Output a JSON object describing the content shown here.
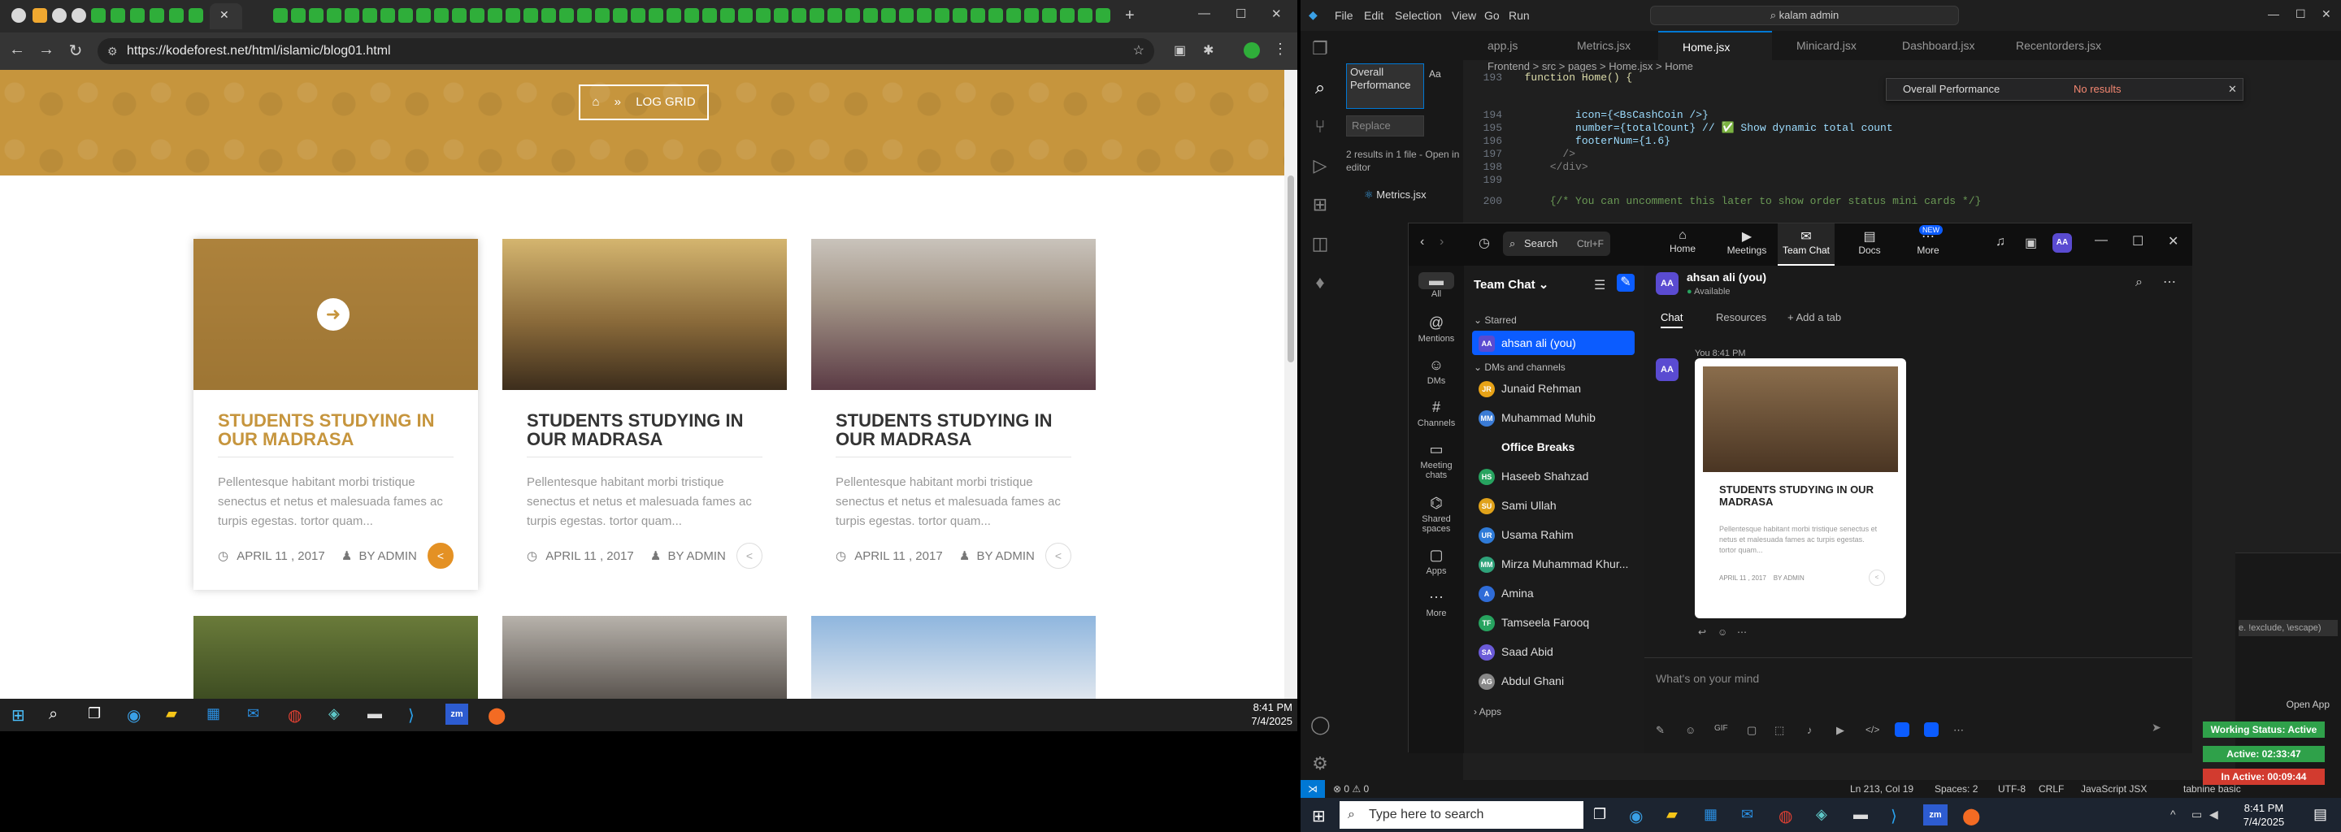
{
  "browser": {
    "url": "https://kodeforest.net/html/islamic/blog01.html",
    "close_tab_glyph": "✕",
    "new_tab_glyph": "+",
    "window_controls": [
      "—",
      "☐",
      "✕"
    ]
  },
  "hero": {
    "breadcrumb_icon": "home-icon",
    "breadcrumb_sep": "»",
    "breadcrumb_label": "LOG GRID"
  },
  "blog_cards": [
    {
      "title": "STUDENTS STUDYING IN OUR MADRASA",
      "desc": "Pellentesque habitant morbi tristique senectus et netus et malesuada fames ac turpis egestas. tortor quam...",
      "date": "APRIL 11 , 2017",
      "author": "BY ADMIN"
    },
    {
      "title": "STUDENTS STUDYING IN OUR MADRASA",
      "desc": "Pellentesque habitant morbi tristique senectus et netus et malesuada fames ac turpis egestas. tortor quam...",
      "date": "APRIL 11 , 2017",
      "author": "BY ADMIN"
    },
    {
      "title": "STUDENTS STUDYING IN OUR MADRASA",
      "desc": "Pellentesque habitant morbi tristique senectus et netus et malesuada fames ac turpis egestas. tortor quam...",
      "date": "APRIL 11 , 2017",
      "author": "BY ADMIN"
    }
  ],
  "left_taskbar": {
    "time": "8:41 PM",
    "date": "7/4/2025"
  },
  "vscode": {
    "menu": [
      "File",
      "Edit",
      "Selection",
      "View",
      "Go",
      "Run"
    ],
    "search_title": "kalam admin",
    "tabs": [
      "app.js",
      "Metrics.jsx",
      "Home.jsx",
      "Minicard.jsx",
      "Dashboard.jsx",
      "Recentorders.jsx"
    ],
    "active_tab": "Home.jsx",
    "breadcrumb": "Frontend > src > pages > Home.jsx > Home",
    "search_input": "Overall Performance",
    "replace_placeholder": "Replace",
    "results_text": "2 results in 1 file - Open in editor",
    "result_file": "Metrics.jsx",
    "find_widget_value": "Overall Performance",
    "find_widget_result": "No results",
    "code_lines": [
      {
        "n": "193",
        "t": "  function Home() {"
      },
      {
        "n": "194",
        "t": "          icon={<BsCashCoin />}"
      },
      {
        "n": "195",
        "t": "          number={totalCount} // ✅ Show dynamic total count"
      },
      {
        "n": "196",
        "t": "          footerNum={1.6}"
      },
      {
        "n": "197",
        "t": "        />"
      },
      {
        "n": "198",
        "t": "      </div>"
      },
      {
        "n": "199",
        "t": ""
      },
      {
        "n": "200",
        "t": "      {/* You can uncomment this later to show order status mini cards */}"
      }
    ],
    "status": {
      "left": "⊗ 0 ⚠ 0",
      "position": "Ln 213, Col 19",
      "spaces": "Spaces: 2",
      "encoding": "UTF-8",
      "eol": "CRLF",
      "lang": "JavaScript JSX",
      "ext": "tabnine basic"
    },
    "regex_hint": "e. !exclude, \\escape)"
  },
  "teams": {
    "search_label": "Search",
    "search_shortcut": "Ctrl+F",
    "nav": [
      "Home",
      "Meetings",
      "Team Chat",
      "Docs",
      "More"
    ],
    "new_badge": "NEW",
    "rail": [
      "All",
      "Mentions",
      "DMs",
      "Channels",
      "Meeting chats",
      "Shared spaces",
      "Apps",
      "More"
    ],
    "list_title": "Team Chat",
    "starred": "Starred",
    "me": "ahsan ali (you)",
    "dms_header": "DMs and channels",
    "contacts": [
      {
        "name": "Junaid Rehman",
        "init": "JR",
        "color": "#e8a317"
      },
      {
        "name": "Muhammad Muhib",
        "init": "MM",
        "color": "#3a7bd5"
      },
      {
        "name": "Office Breaks",
        "init": "",
        "color": "#1b1b1b"
      },
      {
        "name": "Haseeb Shahzad",
        "init": "HS",
        "color": "#27a35f"
      },
      {
        "name": "Sami Ullah",
        "init": "SU",
        "color": "#e0a21a"
      },
      {
        "name": "Usama Rahim",
        "init": "UR",
        "color": "#2f7bd8"
      },
      {
        "name": "Mirza Muhammad Khur...",
        "init": "MM",
        "color": "#2fa37a"
      },
      {
        "name": "Amina",
        "init": "A",
        "color": "#2f6cd8"
      },
      {
        "name": "Tamseela Farooq",
        "init": "TF",
        "color": "#27a35f"
      },
      {
        "name": "Saad Abid",
        "init": "SA",
        "color": "#6b5bd8"
      },
      {
        "name": "Abdul Ghani",
        "init": "AG",
        "color": "#888888"
      }
    ],
    "apps_label": "Apps",
    "chat_user": "ahsan ali (you)",
    "chat_status": "Available",
    "chat_tabs": [
      "Chat",
      "Resources",
      "+ Add a tab"
    ],
    "msg_time": "You 8:41 PM",
    "msg_card": {
      "title": "STUDENTS STUDYING IN OUR MADRASA",
      "desc": "Pellentesque habitant morbi tristique senectus et netus et malesuada fames ac turpis egestas. tortor quam...",
      "date": "APRIL 11 , 2017",
      "author": "BY ADMIN"
    },
    "compose_placeholder": "What's on your mind"
  },
  "overlay": {
    "open_app": "Open App",
    "working_status": "Working Status: Active",
    "active_time": "Active: 02:33:47",
    "inactive_time": "In Active: 00:09:44"
  },
  "right_taskbar": {
    "search_placeholder": "Type here to search",
    "time": "8:41 PM",
    "date": "7/4/2025"
  },
  "colors": {
    "gold": "#c6953d",
    "orange": "#e49124",
    "vscode_blue": "#0078d4",
    "teams_blue": "#0b5cff",
    "green": "#27a35f",
    "red": "#d23b2f"
  }
}
